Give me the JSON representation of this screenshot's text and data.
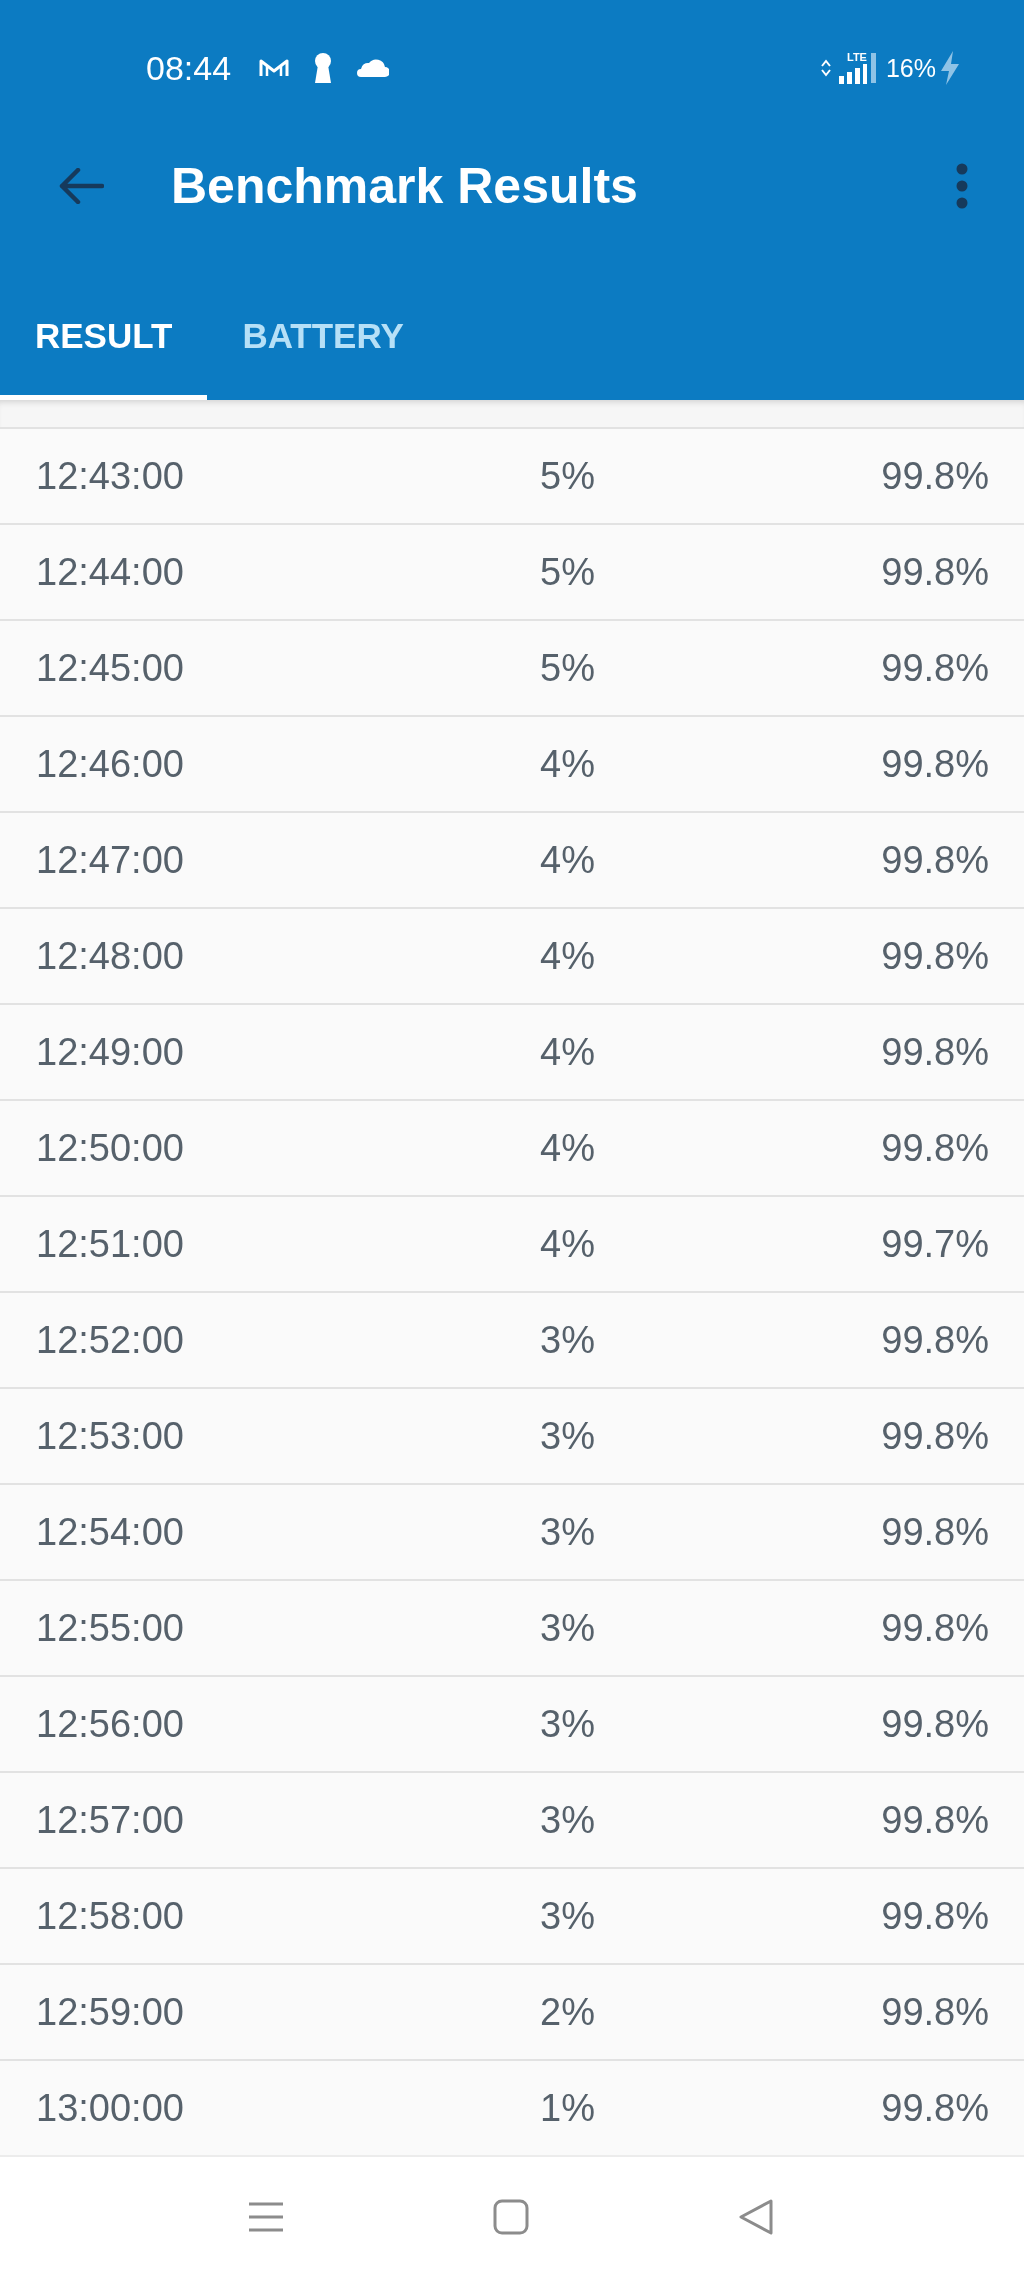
{
  "status_bar": {
    "time": "08:44",
    "network": "LTE",
    "battery": "16%"
  },
  "app_bar": {
    "title": "Benchmark Results"
  },
  "tabs": [
    {
      "label": "RESULT",
      "selected": true
    },
    {
      "label": "BATTERY",
      "selected": false
    }
  ],
  "table": {
    "rows": [
      {
        "cells": [
          "12:43:00",
          "5%",
          "99.8%"
        ]
      },
      {
        "cells": [
          "12:44:00",
          "5%",
          "99.8%"
        ]
      },
      {
        "cells": [
          "12:45:00",
          "5%",
          "99.8%"
        ]
      },
      {
        "cells": [
          "12:46:00",
          "4%",
          "99.8%"
        ]
      },
      {
        "cells": [
          "12:47:00",
          "4%",
          "99.8%"
        ]
      },
      {
        "cells": [
          "12:48:00",
          "4%",
          "99.8%"
        ]
      },
      {
        "cells": [
          "12:49:00",
          "4%",
          "99.8%"
        ]
      },
      {
        "cells": [
          "12:50:00",
          "4%",
          "99.8%"
        ]
      },
      {
        "cells": [
          "12:51:00",
          "4%",
          "99.7%"
        ]
      },
      {
        "cells": [
          "12:52:00",
          "3%",
          "99.8%"
        ]
      },
      {
        "cells": [
          "12:53:00",
          "3%",
          "99.8%"
        ]
      },
      {
        "cells": [
          "12:54:00",
          "3%",
          "99.8%"
        ]
      },
      {
        "cells": [
          "12:55:00",
          "3%",
          "99.8%"
        ]
      },
      {
        "cells": [
          "12:56:00",
          "3%",
          "99.8%"
        ]
      },
      {
        "cells": [
          "12:57:00",
          "3%",
          "99.8%"
        ]
      },
      {
        "cells": [
          "12:58:00",
          "3%",
          "99.8%"
        ]
      },
      {
        "cells": [
          "12:59:00",
          "2%",
          "99.8%"
        ]
      },
      {
        "cells": [
          "13:00:00",
          "1%",
          "99.8%"
        ]
      }
    ]
  }
}
